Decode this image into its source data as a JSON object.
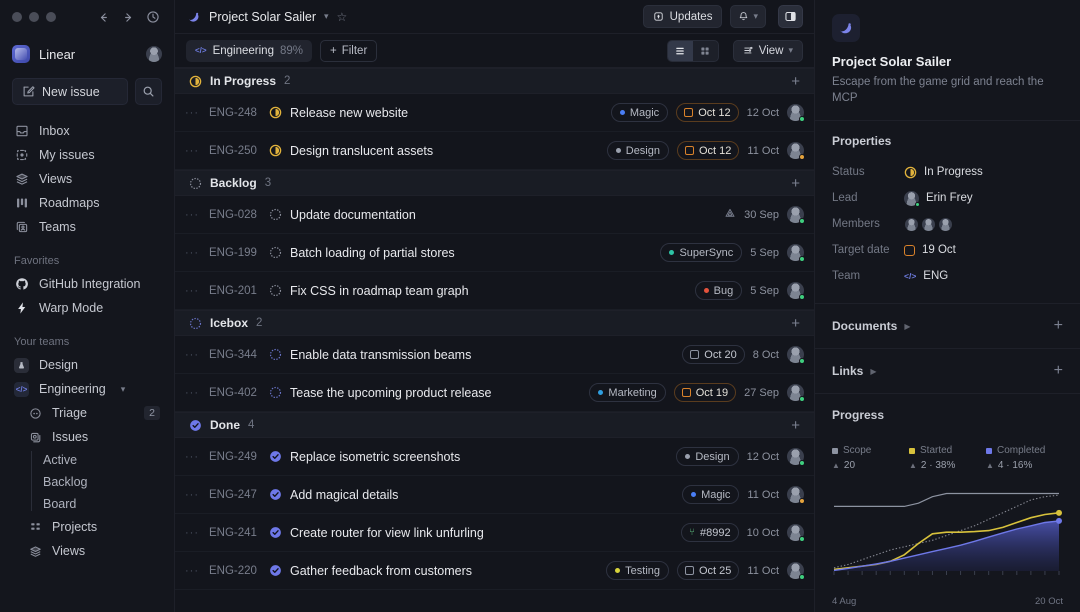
{
  "titlebar": {
    "back_icon": "arrow-left-icon",
    "forward_icon": "arrow-right-icon",
    "history_icon": "clock-icon"
  },
  "sidebar": {
    "brand": "Linear",
    "new_issue_label": "New issue",
    "search_icon": "search-icon",
    "nav": [
      {
        "label": "Inbox",
        "icon": "inbox-icon"
      },
      {
        "label": "My issues",
        "icon": "target-icon"
      },
      {
        "label": "Views",
        "icon": "layers-icon"
      },
      {
        "label": "Roadmaps",
        "icon": "roadmap-icon"
      },
      {
        "label": "Teams",
        "icon": "teams-icon"
      }
    ],
    "favorites_label": "Favorites",
    "favorites": [
      {
        "label": "GitHub Integration",
        "icon": "github-icon"
      },
      {
        "label": "Warp Mode",
        "icon": "bolt-icon"
      }
    ],
    "teams_label": "Your teams",
    "teams": [
      {
        "label": "Design",
        "icon": "design-team-icon",
        "expanded": false
      },
      {
        "label": "Engineering",
        "icon": "code-team-icon",
        "expanded": true
      }
    ],
    "eng_children": [
      {
        "label": "Triage",
        "icon": "triage-icon",
        "count": "2"
      },
      {
        "label": "Issues",
        "icon": "issues-icon"
      }
    ],
    "eng_leaves": [
      "Active",
      "Backlog",
      "Board"
    ],
    "eng_tail": [
      {
        "label": "Projects",
        "icon": "projects-icon"
      },
      {
        "label": "Views",
        "icon": "layers-icon"
      }
    ]
  },
  "header": {
    "project_title": "Project Solar Sailer",
    "updates_label": "Updates",
    "bell_icon": "bell-icon",
    "panel_icon": "right-panel-icon",
    "star_icon": "star-icon"
  },
  "filterbar": {
    "team_name": "Engineering",
    "team_percent": "89%",
    "filter_label": "Filter",
    "view_label": "View",
    "list_icon": "list-view-icon",
    "grid_icon": "grid-view-icon"
  },
  "groups": [
    {
      "name": "In Progress",
      "count": "2",
      "status": "in-progress",
      "rows": [
        {
          "id": "ENG-248",
          "title": "Release new website",
          "status": "in-progress",
          "tag": "Magic",
          "tag_color": "#4a7ef5",
          "date_chip": "Oct 12",
          "date_warn": true,
          "date": "12 Oct",
          "online": "green"
        },
        {
          "id": "ENG-250",
          "title": "Design translucent assets",
          "status": "in-progress",
          "tag": "Design",
          "tag_color": "#9aa0ad",
          "date_chip": "Oct 12",
          "date_warn": true,
          "date": "11 Oct",
          "online": "amber"
        }
      ]
    },
    {
      "name": "Backlog",
      "count": "3",
      "status": "backlog",
      "rows": [
        {
          "id": "ENG-028",
          "title": "Update documentation",
          "status": "backlog",
          "priority_icon": "priority-triangle-icon",
          "date": "30 Sep",
          "online": "green"
        },
        {
          "id": "ENG-199",
          "title": "Batch loading of partial stores",
          "status": "backlog",
          "tag": "SuperSync",
          "tag_color": "#2ec4a6",
          "date": "5 Sep",
          "online": "green"
        },
        {
          "id": "ENG-201",
          "title": "Fix CSS in roadmap team graph",
          "status": "backlog",
          "tag": "Bug",
          "tag_color": "#e5533d",
          "date": "5 Sep",
          "online": "green"
        }
      ]
    },
    {
      "name": "Icebox",
      "count": "2",
      "status": "icebox",
      "rows": [
        {
          "id": "ENG-344",
          "title": "Enable data transmission beams",
          "status": "icebox",
          "date_chip": "Oct 20",
          "date_warn": false,
          "date": "8 Oct",
          "online": "green"
        },
        {
          "id": "ENG-402",
          "title": "Tease the upcoming product release",
          "status": "icebox",
          "tag": "Marketing",
          "tag_color": "#2f9fe0",
          "date_chip": "Oct 19",
          "date_warn": true,
          "date": "27 Sep",
          "online": "green"
        }
      ]
    },
    {
      "name": "Done",
      "count": "4",
      "status": "done",
      "rows": [
        {
          "id": "ENG-249",
          "title": "Replace isometric screenshots",
          "status": "done",
          "tag": "Design",
          "tag_color": "#9aa0ad",
          "date": "12 Oct",
          "online": "green"
        },
        {
          "id": "ENG-247",
          "title": "Add magical details",
          "status": "done",
          "tag": "Magic",
          "tag_color": "#4a7ef5",
          "date": "11 Oct",
          "online": "amber"
        },
        {
          "id": "ENG-241",
          "title": "Create router for view link unfurling",
          "status": "done",
          "git_chip": "#8992",
          "date": "10 Oct",
          "online": "green"
        },
        {
          "id": "ENG-220",
          "title": "Gather feedback from customers",
          "status": "done",
          "tag": "Testing",
          "tag_color": "#d8d43c",
          "date_chip": "Oct 25",
          "date_warn": false,
          "date": "11 Oct",
          "online": "green"
        }
      ]
    }
  ],
  "rightpanel": {
    "project_title": "Project Solar Sailer",
    "project_desc": "Escape from the game grid and reach the MCP",
    "properties_title": "Properties",
    "properties": [
      {
        "key": "Status",
        "value": "In Progress",
        "kind": "status"
      },
      {
        "key": "Lead",
        "value": "Erin Frey",
        "kind": "avatar"
      },
      {
        "key": "Members",
        "value": "",
        "kind": "avatars"
      },
      {
        "key": "Target date",
        "value": "19 Oct",
        "kind": "date"
      },
      {
        "key": "Team",
        "value": "ENG",
        "kind": "team"
      }
    ],
    "documents_label": "Documents",
    "links_label": "Links",
    "progress_title": "Progress"
  },
  "chart_data": {
    "type": "area",
    "title": "Progress",
    "xlabel": "",
    "ylabel": "",
    "x_ticks": [
      "4 Aug",
      "20 Oct"
    ],
    "legend_position": "top",
    "grid": false,
    "legend": [
      {
        "name": "Scope",
        "color": "#8d93a1",
        "value": "20",
        "delta": "20"
      },
      {
        "name": "Started",
        "color": "#d8c23c",
        "value": "2 · 38%",
        "delta": "2"
      },
      {
        "name": "Completed",
        "color": "#6e78e8",
        "value": "4 · 16%",
        "delta": "4"
      }
    ],
    "series": [
      {
        "name": "Scope",
        "color": "#8d93a1",
        "style": "line",
        "values": [
          20,
          20,
          20,
          20,
          20,
          20,
          21,
          23,
          24,
          24,
          24,
          24,
          24,
          24,
          24,
          24,
          24
        ]
      },
      {
        "name": "Projection",
        "color": "#b6b9c4",
        "style": "dotted",
        "values": [
          1,
          2,
          3.5,
          5,
          6.5,
          7.5,
          8.5,
          9.5,
          11,
          12.5,
          14,
          16,
          18,
          20,
          22,
          23,
          23.5
        ]
      },
      {
        "name": "Started",
        "color": "#d8c23c",
        "style": "line",
        "values": [
          0.5,
          1,
          1.5,
          2,
          3,
          5,
          8.5,
          11.5,
          12,
          12,
          12.2,
          12.5,
          13.5,
          15,
          16.5,
          17.5,
          18
        ]
      },
      {
        "name": "Completed",
        "color": "#6e78e8",
        "style": "area",
        "values": [
          0.2,
          0.8,
          1.5,
          2.2,
          3,
          4,
          5,
          6,
          7,
          8,
          9.2,
          10.5,
          11.8,
          13,
          14,
          15,
          15.5
        ]
      }
    ],
    "ylim": [
      0,
      26
    ]
  }
}
